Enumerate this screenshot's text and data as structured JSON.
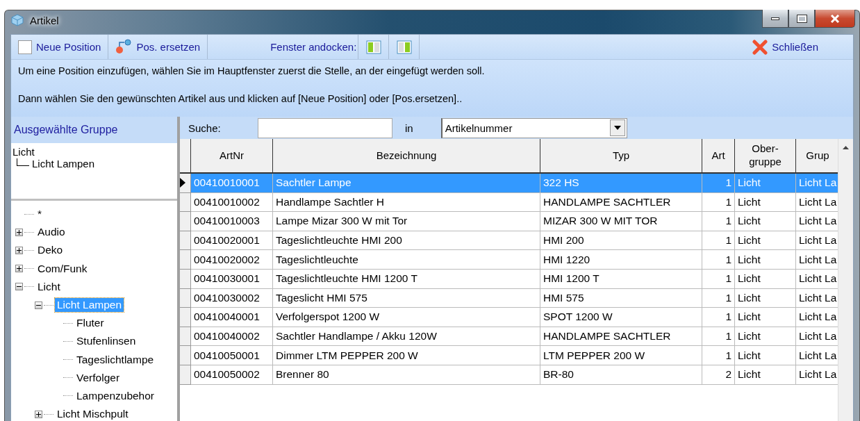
{
  "window": {
    "title": "Artikel"
  },
  "toolbar": {
    "new_position": "Neue Position",
    "replace_position": "Pos. ersetzen",
    "dock_label": "Fenster andocken:",
    "close": "Schließen"
  },
  "info": [
    "Um eine Position einzufügen, wählen Sie im Hauptfenster zuerst die Stelle, an der eingefügt werden soll.",
    "Dann wählen Sie den gewünschten Artikel aus und klicken auf [Neue Position] oder [Pos.ersetzen].."
  ],
  "selected_group": {
    "title": "Ausgewählte Gruppe",
    "path": [
      "Licht",
      "Licht Lampen"
    ]
  },
  "tree": [
    {
      "label": "*",
      "selected": false
    },
    {
      "label": "Audio",
      "selected": false,
      "expanded": false
    },
    {
      "label": "Deko",
      "selected": false,
      "expanded": false
    },
    {
      "label": "Com/Funk",
      "selected": false,
      "expanded": false
    },
    {
      "label": "Licht",
      "selected": false,
      "expanded": true,
      "children": [
        {
          "label": "Licht Lampen",
          "selected": true,
          "expanded": true,
          "children": [
            {
              "label": "Fluter",
              "selected": false
            },
            {
              "label": "Stufenlinsen",
              "selected": false
            },
            {
              "label": "Tageslichtlampe",
              "selected": false
            },
            {
              "label": "Verfolger",
              "selected": false
            },
            {
              "label": "Lampenzubehor",
              "selected": false
            }
          ]
        },
        {
          "label": "Licht Mischpult",
          "selected": false,
          "expanded": false
        }
      ]
    }
  ],
  "search": {
    "label": "Suche:",
    "in_label": "in",
    "field": "Artikelnummer"
  },
  "table": {
    "columns": [
      "ArtNr",
      "Bezeichnung",
      "Typ",
      "Art",
      "Ober-\ngruppe",
      "Grup"
    ],
    "rows": [
      {
        "selected": true,
        "cells": [
          "00410010001",
          "Sachtler Lampe",
          "322 HS",
          "1",
          "Licht",
          "Licht La"
        ]
      },
      {
        "selected": false,
        "cells": [
          "00410010002",
          "Handlampe Sachtler H",
          "HANDLAMPE SACHTLER",
          "1",
          "Licht",
          "Licht La"
        ]
      },
      {
        "selected": false,
        "cells": [
          "00410010003",
          "Lampe Mizar 300 W mit Tor",
          "MIZAR 300 W MIT TOR",
          "1",
          "Licht",
          "Licht La"
        ]
      },
      {
        "selected": false,
        "cells": [
          "00410020001",
          "Tageslichtleuchte HMI 200",
          "HMI 200",
          "1",
          "Licht",
          "Licht La"
        ]
      },
      {
        "selected": false,
        "cells": [
          "00410020002",
          "Tageslichtleuchte",
          "HMI 1220",
          "1",
          "Licht",
          "Licht La"
        ]
      },
      {
        "selected": false,
        "cells": [
          "00410030001",
          "Tageslichtleuchte HMI 1200 T",
          "HMI 1200 T",
          "1",
          "Licht",
          "Licht La"
        ]
      },
      {
        "selected": false,
        "cells": [
          "00410030002",
          "Tageslicht HMI 575",
          "HMI 575",
          "1",
          "Licht",
          "Licht La"
        ]
      },
      {
        "selected": false,
        "cells": [
          "00410040001",
          "Verfolgerspot 1200 W",
          "SPOT 1200 W",
          "1",
          "Licht",
          "Licht La"
        ]
      },
      {
        "selected": false,
        "cells": [
          "00410040002",
          "Sachtler Handlampe / Akku 120W",
          "HANDLAMPE SACHTLER",
          "1",
          "Licht",
          "Licht La"
        ]
      },
      {
        "selected": false,
        "cells": [
          "00410050001",
          "Dimmer LTM PEPPER 200 W",
          "LTM PEPPER 200 W",
          "1",
          "Licht",
          "Licht La"
        ]
      },
      {
        "selected": false,
        "cells": [
          "00410050002",
          "Brenner 80",
          "BR-80",
          "2",
          "Licht",
          "Licht La"
        ]
      }
    ]
  }
}
